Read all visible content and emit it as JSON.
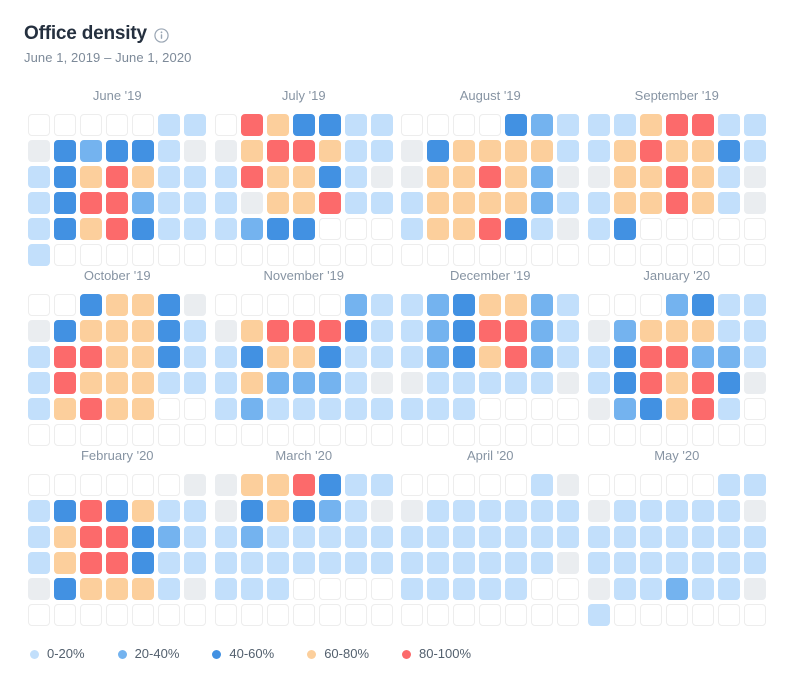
{
  "header": {
    "title": "Office density",
    "info_icon": "info-circle-icon",
    "date_range": "June 1, 2019 – June 1, 2020"
  },
  "legend": {
    "items": [
      {
        "label": "0-20%",
        "color": "#c2dffb",
        "level": 1
      },
      {
        "label": "20-40%",
        "color": "#74b3ef",
        "level": 2
      },
      {
        "label": "40-60%",
        "color": "#4291e2",
        "level": 3
      },
      {
        "label": "60-80%",
        "color": "#fccf9c",
        "level": 4
      },
      {
        "label": "80-100%",
        "color": "#fc6a6b",
        "level": 5
      }
    ]
  },
  "chart_data": {
    "type": "heatmap",
    "title": "Office density",
    "subtitle": "June 1, 2019 – June 1, 2020",
    "xlabel": "",
    "ylabel": "",
    "grid": false,
    "legend_position": "bottom-left",
    "value_scale": [
      {
        "level": 0,
        "name": "empty",
        "range": null,
        "color": "#ffffff"
      },
      {
        "level": -1,
        "name": "no-data",
        "range": null,
        "color": "#eaedf0"
      },
      {
        "level": 1,
        "name": "0-20%",
        "range": [
          0,
          20
        ],
        "color": "#c2dffb"
      },
      {
        "level": 2,
        "name": "20-40%",
        "range": [
          20,
          40
        ],
        "color": "#74b3ef"
      },
      {
        "level": 3,
        "name": "40-60%",
        "range": [
          40,
          60
        ],
        "color": "#4291e2"
      },
      {
        "level": 4,
        "name": "60-80%",
        "range": [
          60,
          80
        ],
        "color": "#fccf9c"
      },
      {
        "level": 5,
        "name": "80-100%",
        "range": [
          80,
          100
        ],
        "color": "#fc6a6b"
      }
    ],
    "cell_columns": 7,
    "cell_rows": 6,
    "months": [
      {
        "label": "June '19",
        "cells": [
          [
            0,
            0,
            0,
            0,
            0,
            1,
            1
          ],
          [
            -1,
            3,
            2,
            3,
            3,
            1,
            -1
          ],
          [
            1,
            3,
            4,
            5,
            4,
            1,
            1
          ],
          [
            1,
            3,
            5,
            5,
            2,
            1,
            1
          ],
          [
            1,
            3,
            4,
            5,
            3,
            1,
            1
          ],
          [
            1,
            0,
            0,
            0,
            0,
            0,
            0
          ]
        ]
      },
      {
        "label": "July '19",
        "cells": [
          [
            0,
            5,
            4,
            3,
            3,
            1,
            1
          ],
          [
            -1,
            4,
            5,
            5,
            4,
            1,
            1
          ],
          [
            1,
            5,
            4,
            4,
            3,
            1,
            -1
          ],
          [
            1,
            -1,
            4,
            4,
            5,
            1,
            1
          ],
          [
            1,
            2,
            3,
            3,
            0,
            0,
            0
          ],
          [
            0,
            0,
            0,
            0,
            0,
            0,
            0
          ]
        ]
      },
      {
        "label": "August '19",
        "cells": [
          [
            0,
            0,
            0,
            0,
            3,
            2,
            1
          ],
          [
            -1,
            3,
            4,
            4,
            4,
            4,
            1
          ],
          [
            -1,
            4,
            4,
            5,
            4,
            2,
            -1
          ],
          [
            1,
            4,
            4,
            4,
            4,
            2,
            1
          ],
          [
            1,
            4,
            4,
            5,
            3,
            1,
            -1
          ],
          [
            0,
            0,
            0,
            0,
            0,
            0,
            0
          ]
        ]
      },
      {
        "label": "September '19",
        "cells": [
          [
            1,
            1,
            4,
            5,
            5,
            1,
            1
          ],
          [
            1,
            4,
            5,
            4,
            4,
            3,
            1
          ],
          [
            -1,
            4,
            4,
            5,
            4,
            1,
            -1
          ],
          [
            1,
            4,
            4,
            5,
            4,
            1,
            -1
          ],
          [
            1,
            3,
            0,
            0,
            0,
            0,
            0
          ],
          [
            0,
            0,
            0,
            0,
            0,
            0,
            0
          ]
        ]
      },
      {
        "label": "October '19",
        "cells": [
          [
            0,
            0,
            3,
            4,
            4,
            3,
            -1
          ],
          [
            -1,
            3,
            4,
            4,
            4,
            3,
            1
          ],
          [
            1,
            5,
            5,
            4,
            4,
            3,
            1
          ],
          [
            1,
            5,
            4,
            4,
            4,
            1,
            1
          ],
          [
            1,
            4,
            5,
            4,
            4,
            0,
            0
          ],
          [
            0,
            0,
            0,
            0,
            0,
            0,
            0
          ]
        ]
      },
      {
        "label": "November '19",
        "cells": [
          [
            0,
            0,
            0,
            0,
            0,
            2,
            1
          ],
          [
            -1,
            4,
            5,
            5,
            5,
            3,
            1
          ],
          [
            1,
            3,
            4,
            4,
            3,
            1,
            1
          ],
          [
            1,
            4,
            2,
            2,
            2,
            1,
            -1
          ],
          [
            1,
            2,
            1,
            1,
            1,
            1,
            1
          ],
          [
            0,
            0,
            0,
            0,
            0,
            0,
            0
          ]
        ]
      },
      {
        "label": "December '19",
        "cells": [
          [
            1,
            2,
            3,
            4,
            4,
            2,
            1
          ],
          [
            1,
            2,
            3,
            5,
            5,
            2,
            1
          ],
          [
            1,
            2,
            3,
            4,
            5,
            2,
            1
          ],
          [
            -1,
            1,
            1,
            1,
            1,
            1,
            -1
          ],
          [
            1,
            1,
            1,
            0,
            0,
            0,
            0
          ],
          [
            0,
            0,
            0,
            0,
            0,
            0,
            0
          ]
        ]
      },
      {
        "label": "January '20",
        "cells": [
          [
            0,
            0,
            0,
            2,
            3,
            1,
            1
          ],
          [
            -1,
            2,
            4,
            4,
            4,
            1,
            1
          ],
          [
            1,
            3,
            5,
            5,
            2,
            2,
            1
          ],
          [
            1,
            3,
            5,
            4,
            5,
            3,
            -1
          ],
          [
            -1,
            2,
            3,
            4,
            5,
            1,
            0
          ],
          [
            0,
            0,
            0,
            0,
            0,
            0,
            0
          ]
        ]
      },
      {
        "label": "February '20",
        "cells": [
          [
            0,
            0,
            0,
            0,
            0,
            0,
            -1
          ],
          [
            1,
            3,
            5,
            3,
            4,
            1,
            1
          ],
          [
            1,
            4,
            5,
            5,
            3,
            2,
            1
          ],
          [
            1,
            4,
            5,
            5,
            3,
            1,
            1
          ],
          [
            -1,
            3,
            4,
            4,
            4,
            1,
            -1
          ],
          [
            0,
            0,
            0,
            0,
            0,
            0,
            0
          ]
        ]
      },
      {
        "label": "March '20",
        "cells": [
          [
            -1,
            4,
            4,
            5,
            3,
            1,
            1
          ],
          [
            -1,
            3,
            4,
            3,
            2,
            1,
            -1
          ],
          [
            1,
            2,
            1,
            1,
            1,
            1,
            1
          ],
          [
            1,
            1,
            1,
            1,
            1,
            1,
            1
          ],
          [
            1,
            1,
            1,
            0,
            0,
            0,
            0
          ],
          [
            0,
            0,
            0,
            0,
            0,
            0,
            0
          ]
        ]
      },
      {
        "label": "April '20",
        "cells": [
          [
            0,
            0,
            0,
            0,
            0,
            1,
            -1
          ],
          [
            -1,
            1,
            1,
            1,
            1,
            1,
            1
          ],
          [
            1,
            1,
            1,
            1,
            1,
            1,
            1
          ],
          [
            1,
            1,
            1,
            1,
            1,
            1,
            -1
          ],
          [
            1,
            1,
            1,
            1,
            1,
            0,
            0
          ],
          [
            0,
            0,
            0,
            0,
            0,
            0,
            0
          ]
        ]
      },
      {
        "label": "May '20",
        "cells": [
          [
            0,
            0,
            0,
            0,
            0,
            1,
            1
          ],
          [
            -1,
            1,
            1,
            1,
            1,
            1,
            -1
          ],
          [
            1,
            1,
            1,
            1,
            1,
            1,
            1
          ],
          [
            1,
            1,
            1,
            1,
            1,
            1,
            1
          ],
          [
            -1,
            1,
            1,
            2,
            1,
            1,
            -1
          ],
          [
            1,
            0,
            0,
            0,
            0,
            0,
            0
          ]
        ]
      }
    ]
  }
}
